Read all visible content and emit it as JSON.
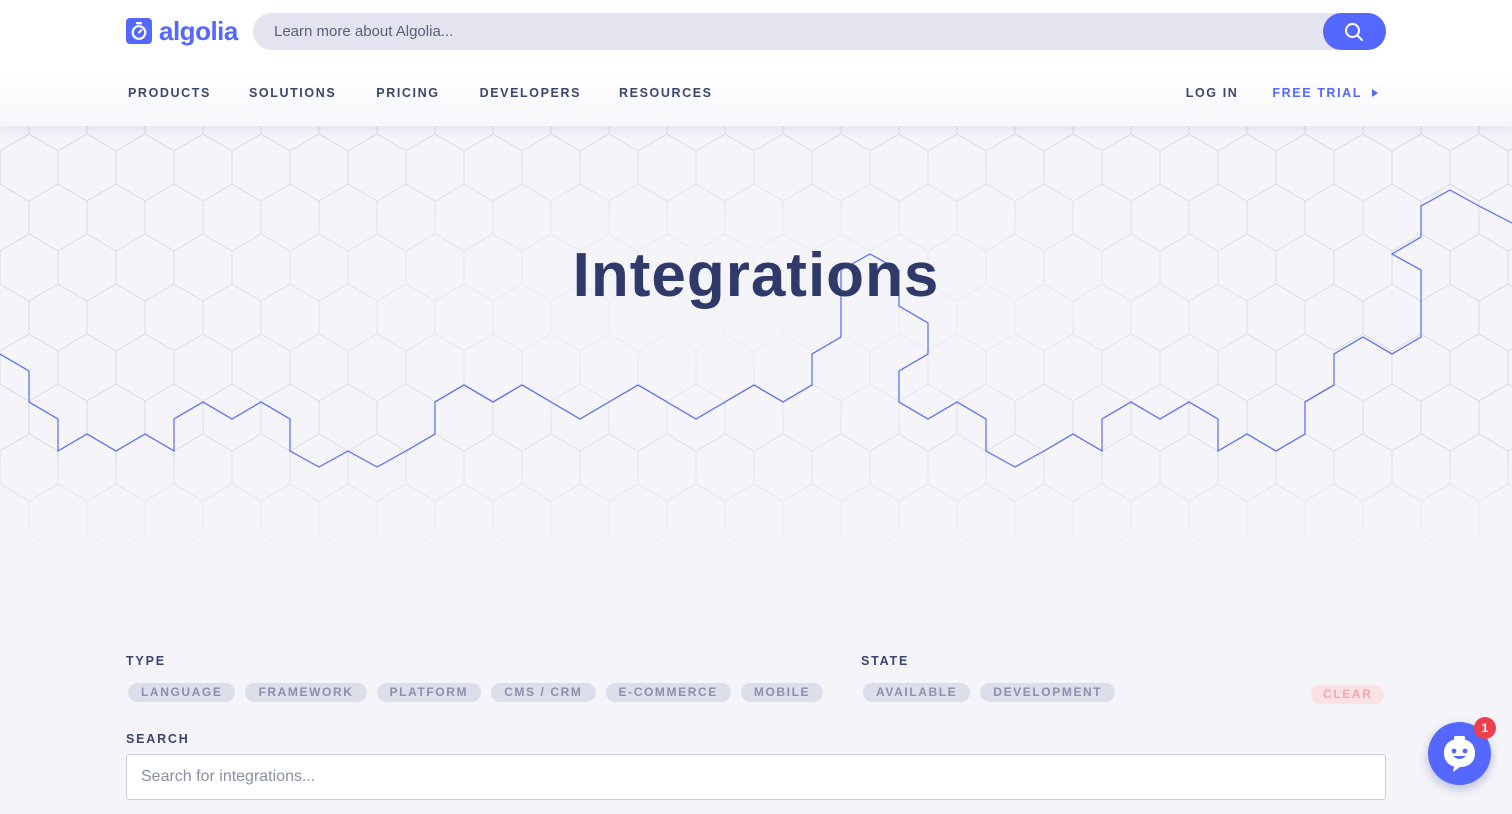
{
  "brand": {
    "name": "algolia",
    "logo_icon": "stopwatch-icon",
    "color": "#5468ff"
  },
  "header_search": {
    "placeholder": "Learn more about Algolia...",
    "button_icon": "search-icon"
  },
  "nav": {
    "items": [
      "PRODUCTS",
      "SOLUTIONS",
      "PRICING",
      "DEVELOPERS",
      "RESOURCES"
    ],
    "login": "LOG IN",
    "free_trial": "FREE TRIAL",
    "free_trial_icon": "caret-right-icon"
  },
  "hero": {
    "title": "Integrations"
  },
  "filters": {
    "type_label": "TYPE",
    "type_options": [
      "LANGUAGE",
      "FRAMEWORK",
      "PLATFORM",
      "CMS / CRM",
      "E-COMMERCE",
      "MOBILE"
    ],
    "state_label": "STATE",
    "state_options": [
      "AVAILABLE",
      "DEVELOPMENT"
    ],
    "clear_label": "CLEAR"
  },
  "search": {
    "label": "SEARCH",
    "placeholder": "Search for integrations..."
  },
  "chat": {
    "icon": "chat-bot-icon",
    "badge_count": "1"
  },
  "colors": {
    "title": "#2f3a6b",
    "accent": "#5468ff",
    "chip_bg": "#dcdeea",
    "clear_bg": "#fce1e4",
    "badge": "#ef3f4d"
  }
}
